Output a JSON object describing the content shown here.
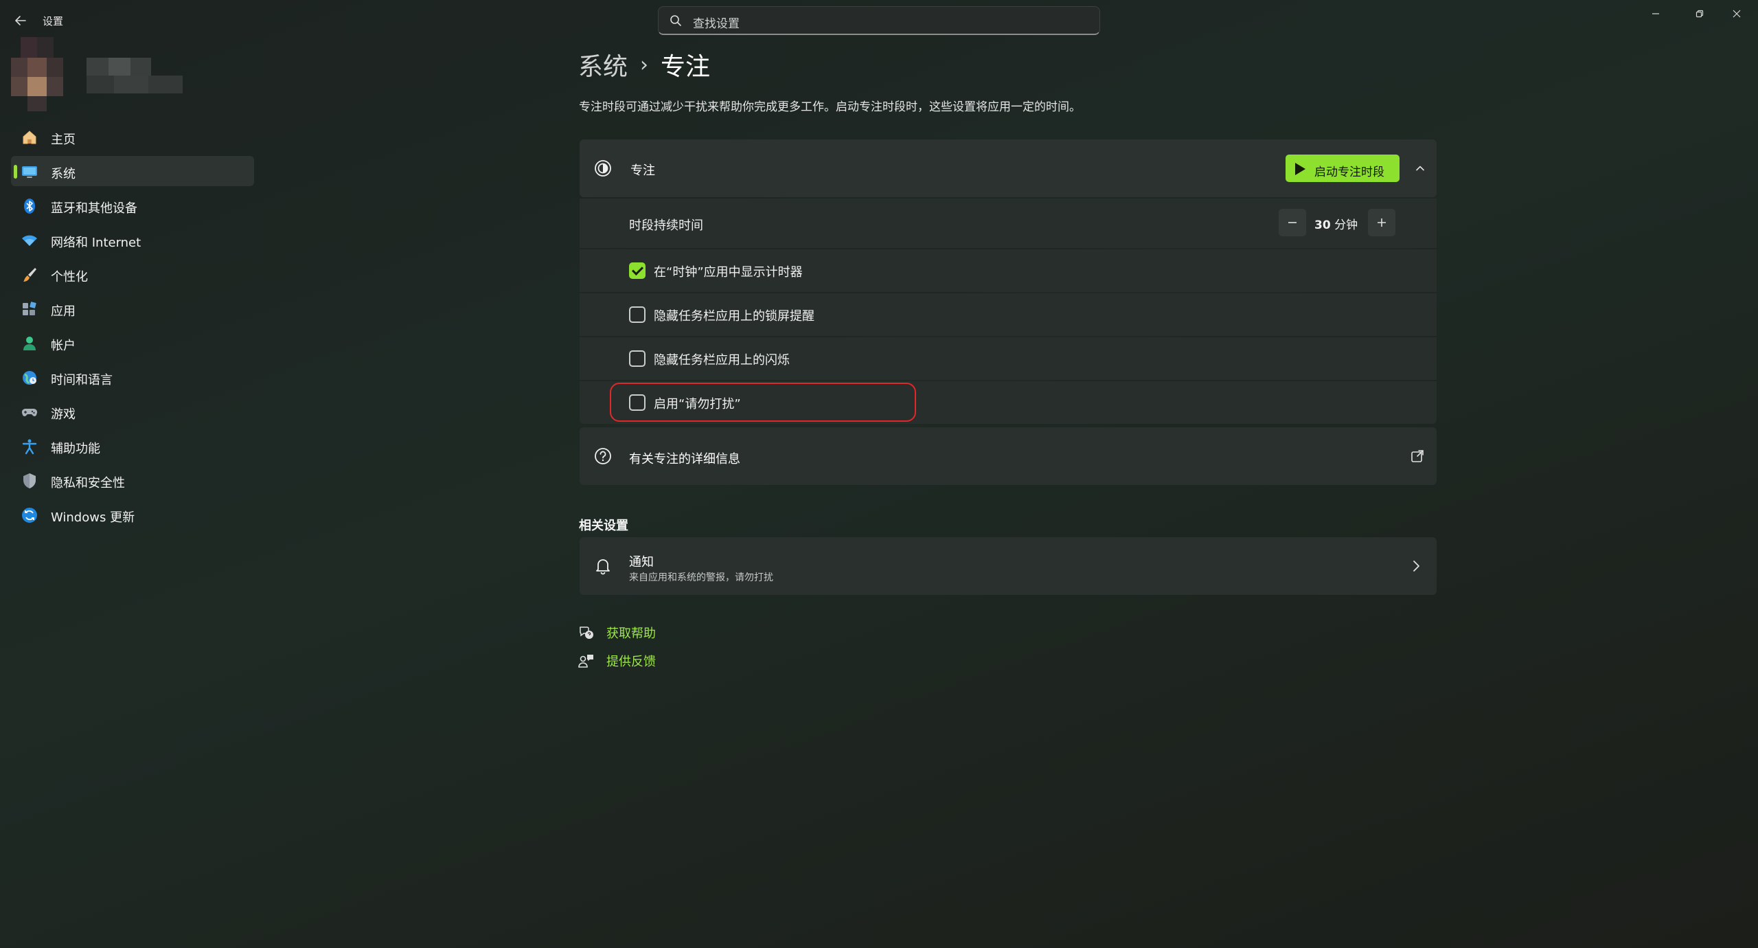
{
  "app": {
    "title": "设置",
    "search_placeholder": "查找设置"
  },
  "sidebar": {
    "items": [
      {
        "label": "主页",
        "icon": "home-icon"
      },
      {
        "label": "系统",
        "icon": "system-icon",
        "selected": true
      },
      {
        "label": "蓝牙和其他设备",
        "icon": "bluetooth-icon"
      },
      {
        "label": "网络和 Internet",
        "icon": "wifi-icon"
      },
      {
        "label": "个性化",
        "icon": "brush-icon"
      },
      {
        "label": "应用",
        "icon": "apps-icon"
      },
      {
        "label": "帐户",
        "icon": "account-icon"
      },
      {
        "label": "时间和语言",
        "icon": "globe-icon"
      },
      {
        "label": "游戏",
        "icon": "gamepad-icon"
      },
      {
        "label": "辅助功能",
        "icon": "accessibility-icon"
      },
      {
        "label": "隐私和安全性",
        "icon": "shield-icon"
      },
      {
        "label": "Windows 更新",
        "icon": "update-icon"
      }
    ]
  },
  "page": {
    "breadcrumb_parent": "系统",
    "breadcrumb_separator": "›",
    "title": "专注",
    "description": "专注时段可通过减少干扰来帮助你完成更多工作。启动专注时段时，这些设置将应用一定的时间。"
  },
  "focus": {
    "label": "专注",
    "start_button": "启动专注时段",
    "duration_label": "时段持续时间",
    "duration_value": "30",
    "duration_unit": "分钟",
    "options": [
      {
        "label": "在“时钟”应用中显示计时器",
        "checked": true
      },
      {
        "label": "隐藏任务栏应用上的锁屏提醒",
        "checked": false
      },
      {
        "label": "隐藏任务栏应用上的闪烁",
        "checked": false
      },
      {
        "label": "启用“请勿打扰”",
        "checked": false
      }
    ]
  },
  "info": {
    "label": "有关专注的详细信息"
  },
  "related": {
    "title": "相关设置",
    "notifications_title": "通知",
    "notifications_subtitle": "来自应用和系统的警报，请勿打扰"
  },
  "links": {
    "help": "获取帮助",
    "feedback": "提供反馈"
  },
  "colors": {
    "accent": "#8ee02e",
    "highlight_outline": "#e0282a"
  }
}
